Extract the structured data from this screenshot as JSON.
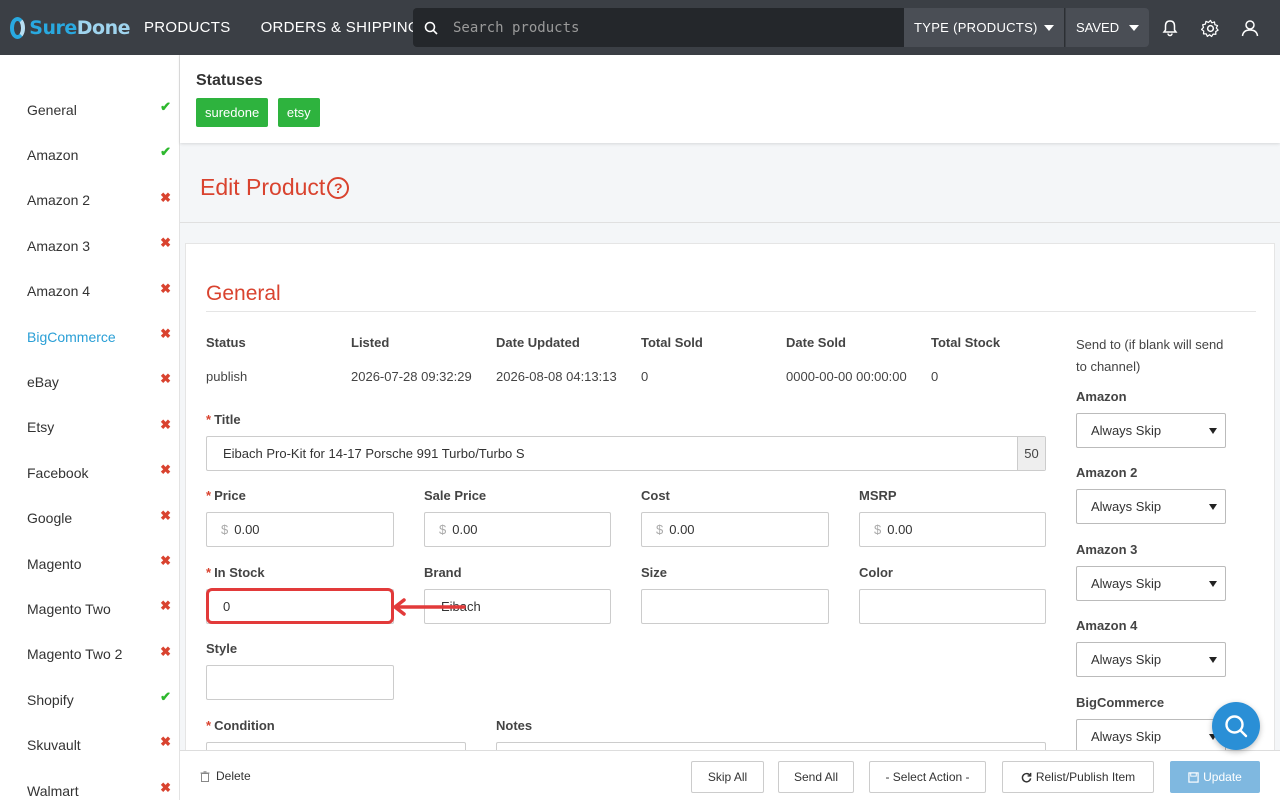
{
  "brand": {
    "logo_text_a": "Sure",
    "logo_text_b": "Done"
  },
  "topnav": {
    "products": "PRODUCTS",
    "orders": "ORDERS & SHIPPING",
    "search_placeholder": "Search products",
    "type_dropdown": "TYPE (PRODUCTS)",
    "saved_dropdown": "SAVED"
  },
  "sidebar": {
    "items": [
      {
        "label": "General",
        "status": "ok"
      },
      {
        "label": "Amazon",
        "status": "ok"
      },
      {
        "label": "Amazon 2",
        "status": "bad"
      },
      {
        "label": "Amazon 3",
        "status": "bad"
      },
      {
        "label": "Amazon 4",
        "status": "bad"
      },
      {
        "label": "BigCommerce",
        "status": "bad",
        "active": true
      },
      {
        "label": "eBay",
        "status": "bad"
      },
      {
        "label": "Etsy",
        "status": "bad"
      },
      {
        "label": "Facebook",
        "status": "bad"
      },
      {
        "label": "Google",
        "status": "bad"
      },
      {
        "label": "Magento",
        "status": "bad"
      },
      {
        "label": "Magento Two",
        "status": "bad"
      },
      {
        "label": "Magento Two 2",
        "status": "bad"
      },
      {
        "label": "Shopify",
        "status": "ok"
      },
      {
        "label": "Skuvault",
        "status": "bad"
      },
      {
        "label": "Walmart",
        "status": "bad"
      }
    ]
  },
  "statuses": {
    "title": "Statuses",
    "badges": [
      "suredone",
      "etsy"
    ]
  },
  "page": {
    "title": "Edit Product",
    "help_glyph": "?"
  },
  "general": {
    "section_title": "General",
    "meta_headers": [
      "Status",
      "Listed",
      "Date Updated",
      "Total Sold",
      "Date Sold",
      "Total Stock"
    ],
    "meta_values": [
      "publish",
      "2026-07-28 09:32:29",
      "2026-08-08 04:13:13",
      "0",
      "0000-00-00 00:00:00",
      "0"
    ],
    "title_label": "Title",
    "title_value": "Eibach Pro-Kit for 14-17 Porsche 991 Turbo/Turbo S",
    "title_counter": "50",
    "price_label": "Price",
    "price_value": "0.00",
    "sale_price_label": "Sale Price",
    "sale_price_value": "0.00",
    "cost_label": "Cost",
    "cost_value": "0.00",
    "msrp_label": "MSRP",
    "msrp_value": "0.00",
    "currency_symbol": "$",
    "in_stock_label": "In Stock",
    "in_stock_value": "0",
    "brand_label": "Brand",
    "brand_value": "Eibach",
    "size_label": "Size",
    "size_value": "",
    "color_label": "Color",
    "color_value": "",
    "style_label": "Style",
    "style_value": "",
    "condition_label": "Condition",
    "notes_label": "Notes",
    "required_mark": "*"
  },
  "send_to": {
    "note": "Send to (if blank will send to channel)",
    "channels": [
      {
        "label": "Amazon",
        "value": "Always Skip"
      },
      {
        "label": "Amazon 2",
        "value": "Always Skip"
      },
      {
        "label": "Amazon 3",
        "value": "Always Skip"
      },
      {
        "label": "Amazon 4",
        "value": "Always Skip"
      },
      {
        "label": "BigCommerce",
        "value": "Always Skip"
      }
    ]
  },
  "bottombar": {
    "delete": "Delete",
    "skip_all": "Skip All",
    "send_all": "Send All",
    "select_action": "- Select Action -",
    "relist": "Relist/Publish Item",
    "update": "Update"
  },
  "colors": {
    "accent_red": "#d9432f",
    "badge_green": "#2eb33e",
    "topbar": "#3b3f45",
    "link_blue": "#2a9fd6",
    "annotation_red": "#e23a3a"
  }
}
